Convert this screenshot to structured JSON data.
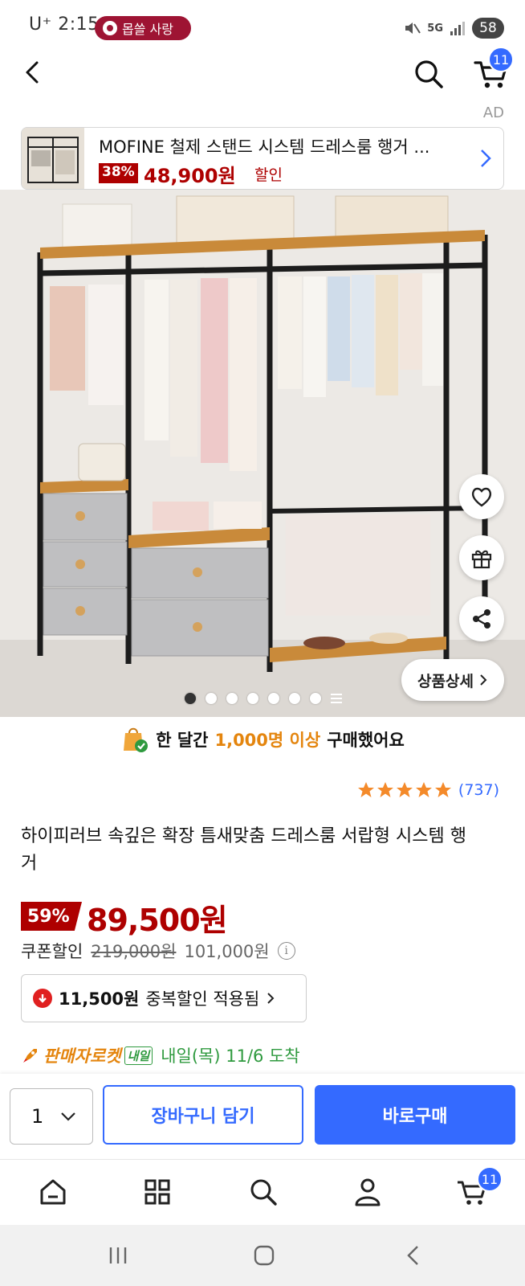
{
  "status_bar": {
    "carrier_time": "U⁺ 2:15",
    "notification_pill": "몹쓸 사랑",
    "network": "5G",
    "battery": "58"
  },
  "header": {
    "cart_badge": "11"
  },
  "ad": {
    "label": "AD",
    "title": "MOFINE 철제 스탠드 시스템 드레스룸 행거 ...",
    "discount": "38%",
    "price": "48,900원",
    "discount_label": "할인"
  },
  "gallery": {
    "detail_button": "상품상세",
    "page_count": 7,
    "active_index": 0
  },
  "purchase_note": {
    "prefix": "한 달간",
    "highlight": "1,000명 이상",
    "suffix": "구매했어요"
  },
  "rating": {
    "stars": 5,
    "count": "(737)"
  },
  "product": {
    "title": "하이피러브 속깊은 확장 틈새맞춤 드레스룸 서랍형 시스템 행거",
    "discount_rate": "59%",
    "sale_price": "89,500원",
    "coupon_label": "쿠폰할인",
    "original_price": "219,000원",
    "base_price": "101,000원",
    "dup_amount": "11,500원",
    "dup_label": "중복할인 적용됨"
  },
  "delivery": {
    "seller_rocket": "판매자로켓",
    "tag": "내일",
    "eta": "내일(목) 11/6 도착"
  },
  "buy_bar": {
    "quantity": "1",
    "add_to_cart": "장바구니 담기",
    "buy_now": "바로구매"
  },
  "bottom_nav": {
    "cart_badge": "11"
  },
  "colors": {
    "accent_blue": "#346aff",
    "sale_red": "#ae0000",
    "rocket_green": "#2f9a3f",
    "highlight_orange": "#e4850e"
  }
}
